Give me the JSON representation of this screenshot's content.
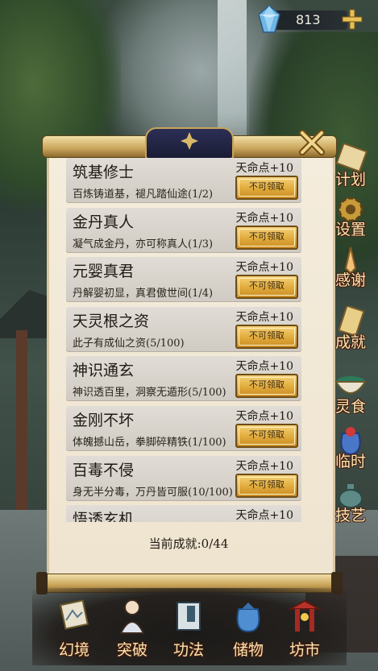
{
  "currency": {
    "value": "813",
    "icon": "crystal-gem-icon",
    "add_icon": "plus-icon"
  },
  "achievements": [
    {
      "title": "筑基修士",
      "desc": "百炼铸道基，褪凡踏仙途(1/2)",
      "reward": "天命点+10",
      "button": "不可领取"
    },
    {
      "title": "金丹真人",
      "desc": "凝气成金丹，亦可称真人(1/3)",
      "reward": "天命点+10",
      "button": "不可领取"
    },
    {
      "title": "元婴真君",
      "desc": "丹解婴初显，真君傲世间(1/4)",
      "reward": "天命点+10",
      "button": "不可领取"
    },
    {
      "title": "天灵根之资",
      "desc": "此子有成仙之资(5/100)",
      "reward": "天命点+10",
      "button": "不可领取"
    },
    {
      "title": "神识通玄",
      "desc": "神识透百里，洞察无遁形(5/100)",
      "reward": "天命点+10",
      "button": "不可领取"
    },
    {
      "title": "金刚不坏",
      "desc": "体魄撼山岳，拳脚碎精铁(1/100)",
      "reward": "天命点+10",
      "button": "不可领取"
    },
    {
      "title": "百毒不侵",
      "desc": "身无半分毒，万丹皆可服(10/100)",
      "reward": "天命点+10",
      "button": "不可领取"
    },
    {
      "title": "悟透玄机",
      "desc": "",
      "reward": "天命点+10",
      "button": ""
    }
  ],
  "progress_label": "当前成就:0/44",
  "side_menu": [
    {
      "label": "计划",
      "icon": "scroll-plan-icon"
    },
    {
      "label": "设置",
      "icon": "gear-icon"
    },
    {
      "label": "感谢",
      "icon": "praying-hands-icon"
    },
    {
      "label": "成就",
      "icon": "achievement-scroll-icon"
    },
    {
      "label": "灵食",
      "icon": "food-bowl-icon"
    },
    {
      "label": "临时",
      "icon": "pouch-icon"
    },
    {
      "label": "技艺",
      "icon": "teapot-icon"
    }
  ],
  "bottom_nav": [
    {
      "label": "幻境",
      "icon": "painting-scroll-icon"
    },
    {
      "label": "突破",
      "icon": "cultivator-icon"
    },
    {
      "label": "功法",
      "icon": "book-icon"
    },
    {
      "label": "储物",
      "icon": "storage-bag-icon"
    },
    {
      "label": "坊市",
      "icon": "market-gate-icon"
    }
  ]
}
